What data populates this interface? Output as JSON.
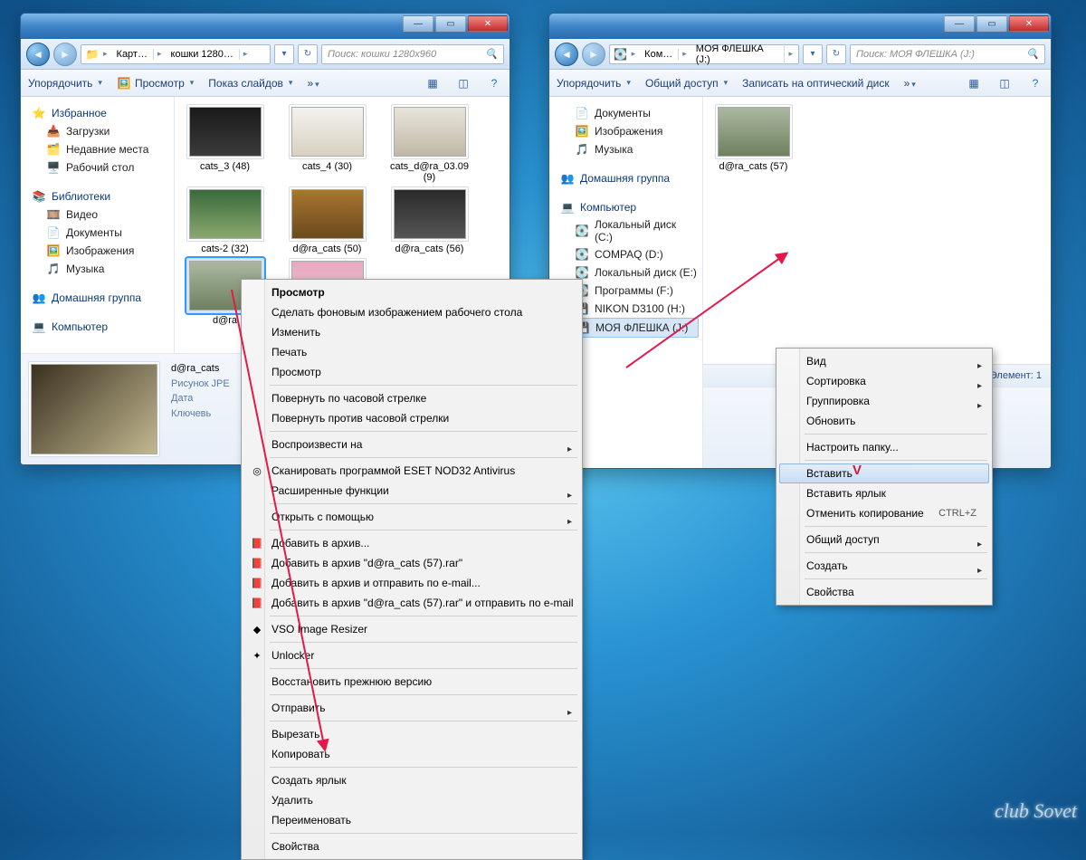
{
  "watermark": "club Sovet",
  "window1": {
    "winctrls": {
      "min": "—",
      "max": "▭",
      "close": "✕"
    },
    "breadcrumb": [
      "Карт…",
      "кошки 1280…"
    ],
    "search_placeholder": "Поиск: кошки 1280x960",
    "toolbar": {
      "organize": "Упорядочить",
      "preview": "Просмотр",
      "slideshow": "Показ слайдов"
    },
    "nav": {
      "favorites": {
        "head": "Избранное",
        "items": [
          "Загрузки",
          "Недавние места",
          "Рабочий стол"
        ]
      },
      "libraries": {
        "head": "Библиотеки",
        "items": [
          "Видео",
          "Документы",
          "Изображения",
          "Музыка"
        ]
      },
      "homegroup": "Домашняя группа",
      "computer": "Компьютер"
    },
    "thumbs": [
      {
        "label": "cats_3 (48)",
        "t": 0
      },
      {
        "label": "cats_4 (30)",
        "t": 1
      },
      {
        "label": "cats_d@ra_03.09 (9)",
        "t": 2
      },
      {
        "label": "cats-2 (32)",
        "t": 3
      },
      {
        "label": "d@ra_cats (50)",
        "t": 4
      },
      {
        "label": "d@ra_cats (56)",
        "t": 5
      },
      {
        "label": "d@ra",
        "t": 6,
        "selected": true
      },
      {
        "label": "",
        "t": 7
      }
    ],
    "details": {
      "name": "d@ra_cats",
      "type": "Рисунок JPE",
      "date_label": "Дата",
      "keywords_label": "Ключевь"
    }
  },
  "window2": {
    "winctrls": {
      "min": "—",
      "max": "▭",
      "close": "✕"
    },
    "breadcrumb": [
      "Ком…",
      "МОЯ ФЛЕШКА (J:)"
    ],
    "search_placeholder": "Поиск: МОЯ ФЛЕШКА (J:)",
    "toolbar": {
      "organize": "Упорядочить",
      "share": "Общий доступ",
      "burn": "Записать на оптический диск"
    },
    "nav": {
      "libs": [
        "Документы",
        "Изображения",
        "Музыка"
      ],
      "homegroup": "Домашняя группа",
      "computer": "Компьютер",
      "drives": [
        "Локальный диск (C:)",
        "COMPAQ (D:)",
        "Локальный диск (E:)",
        "Программы  (F:)",
        "NIKON D3100 (H:)",
        "МОЯ ФЛЕШКА (J:)"
      ]
    },
    "thumbs": [
      {
        "label": "d@ra_cats (57)",
        "t": 6
      }
    ],
    "status": "Элемент: 1"
  },
  "ctx_left": {
    "items": [
      {
        "t": "Просмотр",
        "bold": true
      },
      {
        "t": "Сделать фоновым изображением рабочего стола"
      },
      {
        "t": "Изменить"
      },
      {
        "t": "Печать"
      },
      {
        "t": "Просмотр"
      },
      {
        "sep": true
      },
      {
        "t": "Повернуть по часовой стрелке"
      },
      {
        "t": "Повернуть против часовой стрелки"
      },
      {
        "sep": true
      },
      {
        "t": "Воспроизвести на",
        "sub": true
      },
      {
        "sep": true
      },
      {
        "t": "Сканировать программой ESET NOD32 Antivirus",
        "ico": "◎"
      },
      {
        "t": "Расширенные функции",
        "sub": true
      },
      {
        "sep": true
      },
      {
        "t": "Открыть с помощью",
        "sub": true
      },
      {
        "sep": true
      },
      {
        "t": "Добавить в архив...",
        "ico": "📕"
      },
      {
        "t": "Добавить в архив \"d@ra_cats (57).rar\"",
        "ico": "📕"
      },
      {
        "t": "Добавить в архив и отправить по e-mail...",
        "ico": "📕"
      },
      {
        "t": "Добавить в архив \"d@ra_cats (57).rar\" и отправить по e-mail",
        "ico": "📕"
      },
      {
        "sep": true
      },
      {
        "t": "VSO Image Resizer",
        "ico": "◆"
      },
      {
        "sep": true
      },
      {
        "t": "Unlocker",
        "ico": "✦"
      },
      {
        "sep": true
      },
      {
        "t": "Восстановить прежнюю версию"
      },
      {
        "sep": true
      },
      {
        "t": "Отправить",
        "sub": true
      },
      {
        "sep": true
      },
      {
        "t": "Вырезать"
      },
      {
        "t": "Копировать"
      },
      {
        "sep": true
      },
      {
        "t": "Создать ярлык"
      },
      {
        "t": "Удалить"
      },
      {
        "t": "Переименовать"
      },
      {
        "sep": true
      },
      {
        "t": "Свойства"
      }
    ]
  },
  "ctx_right": {
    "items": [
      {
        "t": "Вид",
        "sub": true
      },
      {
        "t": "Сортировка",
        "sub": true
      },
      {
        "t": "Группировка",
        "sub": true
      },
      {
        "t": "Обновить"
      },
      {
        "sep": true
      },
      {
        "t": "Настроить папку..."
      },
      {
        "sep": true
      },
      {
        "t": "Вставить",
        "sel": true
      },
      {
        "t": "Вставить ярлык"
      },
      {
        "t": "Отменить копирование",
        "shortcut": "CTRL+Z"
      },
      {
        "sep": true
      },
      {
        "t": "Общий доступ",
        "sub": true
      },
      {
        "sep": true
      },
      {
        "t": "Создать",
        "sub": true
      },
      {
        "sep": true
      },
      {
        "t": "Свойства"
      }
    ]
  }
}
